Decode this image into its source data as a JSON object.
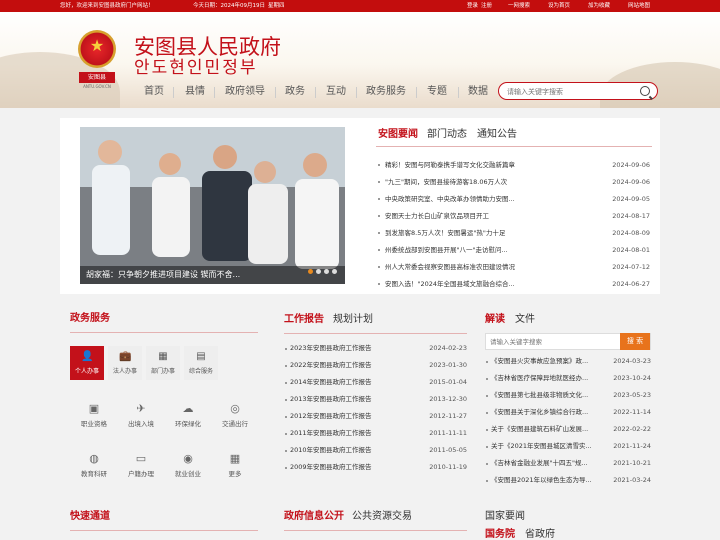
{
  "topbar": {
    "welcome": "您好，欢迎来到安图县政府门户网站！",
    "date": "今天日期：2024年09月19日",
    "weekday": "星期四",
    "login": "登录",
    "register": "注册",
    "onebrowse": "一网搜索",
    "homepage": "设为首页",
    "favorite": "加为收藏",
    "sitemap": "网站地图"
  },
  "header": {
    "emblem_label": "安图县",
    "emblem_sub": "ANTU.GOV.CN",
    "title": "安图县人民政府",
    "subtitle": "안도현인민정부"
  },
  "nav": [
    "首页",
    "县情",
    "政府领导",
    "政务",
    "互动",
    "政务服务",
    "专题",
    "数据"
  ],
  "search": {
    "placeholder": "请输入关键字搜索"
  },
  "colors": {
    "brand_red": "#c3111a",
    "accent_orange": "#e8731c"
  },
  "slider": {
    "caption": "胡家福：只争朝夕推进项目建设 锲而不舍...",
    "dot_count": 4,
    "active_dot": 0
  },
  "news": {
    "tabs": [
      "安图要闻",
      "部门动态",
      "通知公告"
    ],
    "items": [
      {
        "title": "精彩！安图与阿勒泰携手谱写文化交融新篇章",
        "date": "2024-09-06"
      },
      {
        "title": "\"九三\"期间，安图县接待游客18.06万人次",
        "date": "2024-09-06"
      },
      {
        "title": "中央政策研究室、中央改革办领情助力安图...",
        "date": "2024-09-05"
      },
      {
        "title": "安图天士力长白山矿泉饮品项目开工",
        "date": "2024-08-17"
      },
      {
        "title": "到发旅客8.5万人次！安图暑运\"热\"力十足",
        "date": "2024-08-09"
      },
      {
        "title": "州委统战部到安图县开展\"八一\"走访慰问...",
        "date": "2024-08-01"
      },
      {
        "title": "州人大常委会视察安图县高标准农田建设情况",
        "date": "2024-07-12"
      },
      {
        "title": "安图入选！\"2024年全国县域文旅融合综合...",
        "date": "2024-06-27"
      }
    ]
  },
  "services": {
    "title": "政务服务",
    "buttons": [
      {
        "label": "个人办事",
        "icon": "person-icon"
      },
      {
        "label": "法人办事",
        "icon": "briefcase-icon"
      },
      {
        "label": "部门办事",
        "icon": "building-icon"
      },
      {
        "label": "综合服务",
        "icon": "office-icon"
      }
    ],
    "items": [
      {
        "label": "职业资格",
        "icon": "certificate-icon"
      },
      {
        "label": "出境入境",
        "icon": "plane-icon"
      },
      {
        "label": "环保绿化",
        "icon": "weather-icon"
      },
      {
        "label": "交通出行",
        "icon": "ball-icon"
      },
      {
        "label": "教育科研",
        "icon": "planet-icon"
      },
      {
        "label": "户籍办理",
        "icon": "id-card-icon"
      },
      {
        "label": "就业创业",
        "icon": "money-icon"
      },
      {
        "label": "更多",
        "icon": "grid-icon"
      }
    ]
  },
  "reports": {
    "title": "工作报告",
    "title2": "规划计划",
    "items": [
      {
        "title": "2023年安图县政府工作报告",
        "date": "2024-02-23"
      },
      {
        "title": "2022年安图县政府工作报告",
        "date": "2023-01-30"
      },
      {
        "title": "2014年安图县政府工作报告",
        "date": "2015-01-04"
      },
      {
        "title": "2013年安图县政府工作报告",
        "date": "2013-12-30"
      },
      {
        "title": "2012年安图县政府工作报告",
        "date": "2012-11-27"
      },
      {
        "title": "2011年安图县政府工作报告",
        "date": "2011-11-11"
      },
      {
        "title": "2010年安图县政府工作报告",
        "date": "2011-05-05"
      },
      {
        "title": "2009年安图县政府工作报告",
        "date": "2010-11-19"
      }
    ]
  },
  "interpret": {
    "title": "解读",
    "title2": "文件",
    "search_placeholder": "请输入关键字搜索",
    "search_btn": "搜 索",
    "items": [
      {
        "title": "《安图县火灾事故应急预案》政...",
        "date": "2024-03-23"
      },
      {
        "title": "《吉林省医疗保障异地就医经办...",
        "date": "2023-10-24"
      },
      {
        "title": "《安图县第七批县级非物质文化...",
        "date": "2023-05-23"
      },
      {
        "title": "《安图县关于深化乡镇综合行政...",
        "date": "2022-11-14"
      },
      {
        "title": "关于《安图县建筑石料矿山发展...",
        "date": "2022-02-22"
      },
      {
        "title": "关于《2021年安图县城区清雪实...",
        "date": "2021-11-24"
      },
      {
        "title": "《吉林省金融业发展\"十四五\"规...",
        "date": "2021-10-21"
      },
      {
        "title": "《安图县2021年以绿色生态为导...",
        "date": "2021-03-24"
      }
    ]
  },
  "bottom": {
    "fast": "快速通道",
    "info_open": "政府信息公开",
    "public_res": "公共资源交易",
    "national": "国家要闻",
    "gwy": "国务院",
    "province": "省政府"
  }
}
